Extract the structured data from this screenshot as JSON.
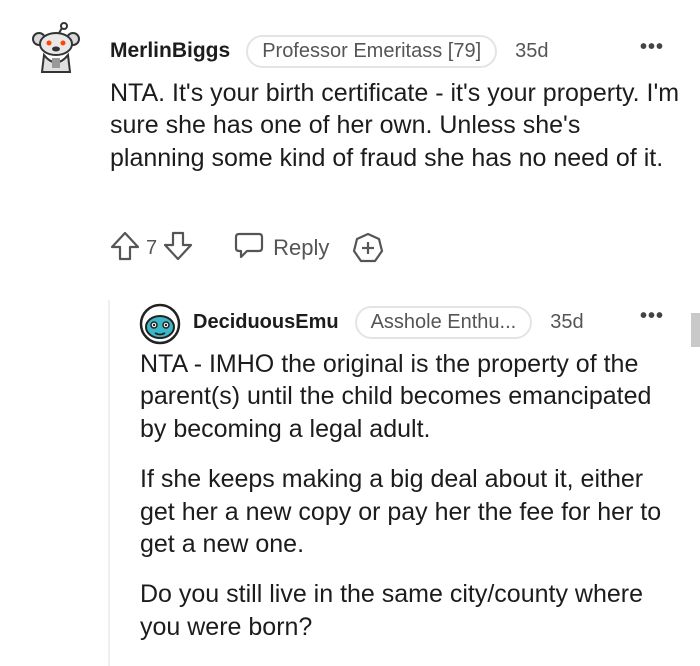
{
  "comments": [
    {
      "username": "MerlinBiggs",
      "flair": "Professor Emeritass [79]",
      "age": "35d",
      "more": "•••",
      "body": [
        "NTA. It's your birth certificate - it's your property. I'm sure she has one of her own. Unless she's planning some kind of fraud she has no need of it."
      ],
      "score": "7",
      "reply_label": "Reply"
    },
    {
      "username": "DeciduousEmu",
      "flair": "Asshole Enthu...",
      "age": "35d",
      "more": "•••",
      "body": [
        "NTA - IMHO the original is the property of the parent(s) until the child becomes emancipated by becoming a legal adult.",
        "If she keeps making a big deal about it, either get her a new copy or pay her the fee for her to get a new one.",
        "Do you still live in the same city/county where you were born?"
      ]
    }
  ],
  "icons": {
    "avatar_1": "snoo-avatar-icon",
    "avatar_2": "emu-avatar-icon",
    "upvote": "arrow-up-icon",
    "downvote": "arrow-down-icon",
    "reply": "speech-bubble-icon",
    "award": "plus-circle-icon"
  }
}
